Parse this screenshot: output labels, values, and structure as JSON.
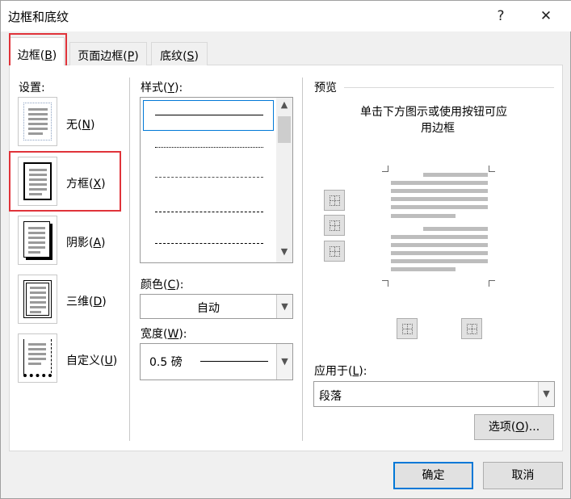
{
  "window": {
    "title": "边框和底纹",
    "help": "?",
    "close": "✕"
  },
  "tabs": [
    {
      "pre": "边框(",
      "key": "B",
      "post": ")"
    },
    {
      "pre": "页面边框(",
      "key": "P",
      "post": ")"
    },
    {
      "pre": "底纹(",
      "key": "S",
      "post": ")"
    }
  ],
  "settings": {
    "label": "设置:",
    "items": [
      {
        "pre": "无(",
        "key": "N",
        "post": ")"
      },
      {
        "pre": "方框(",
        "key": "X",
        "post": ")"
      },
      {
        "pre": "阴影(",
        "key": "A",
        "post": ")"
      },
      {
        "pre": "三维(",
        "key": "D",
        "post": ")"
      },
      {
        "pre": "自定义(",
        "key": "U",
        "post": ")"
      }
    ]
  },
  "style": {
    "pre": "样式(",
    "key": "Y",
    "post": "):",
    "options": [
      "solid",
      "dotted",
      "dashed-fine",
      "dashed",
      "dash-dot"
    ],
    "selected": "solid"
  },
  "color": {
    "pre": "颜色(",
    "key": "C",
    "post": "):",
    "value": "自动"
  },
  "width": {
    "pre": "宽度(",
    "key": "W",
    "post": "):",
    "value": "0.5 磅"
  },
  "preview": {
    "label": "预览",
    "instruction_line1": "单击下方图示或使用按钮可应",
    "instruction_line2": "用边框"
  },
  "apply_to": {
    "pre": "应用于(",
    "key": "L",
    "post": "):",
    "value": "段落"
  },
  "buttons": {
    "options_pre": "选项(",
    "options_key": "O",
    "options_post": ")...",
    "ok": "确定",
    "cancel": "取消"
  },
  "colors": {
    "highlight": "#e0333a",
    "accent": "#0078d7"
  }
}
